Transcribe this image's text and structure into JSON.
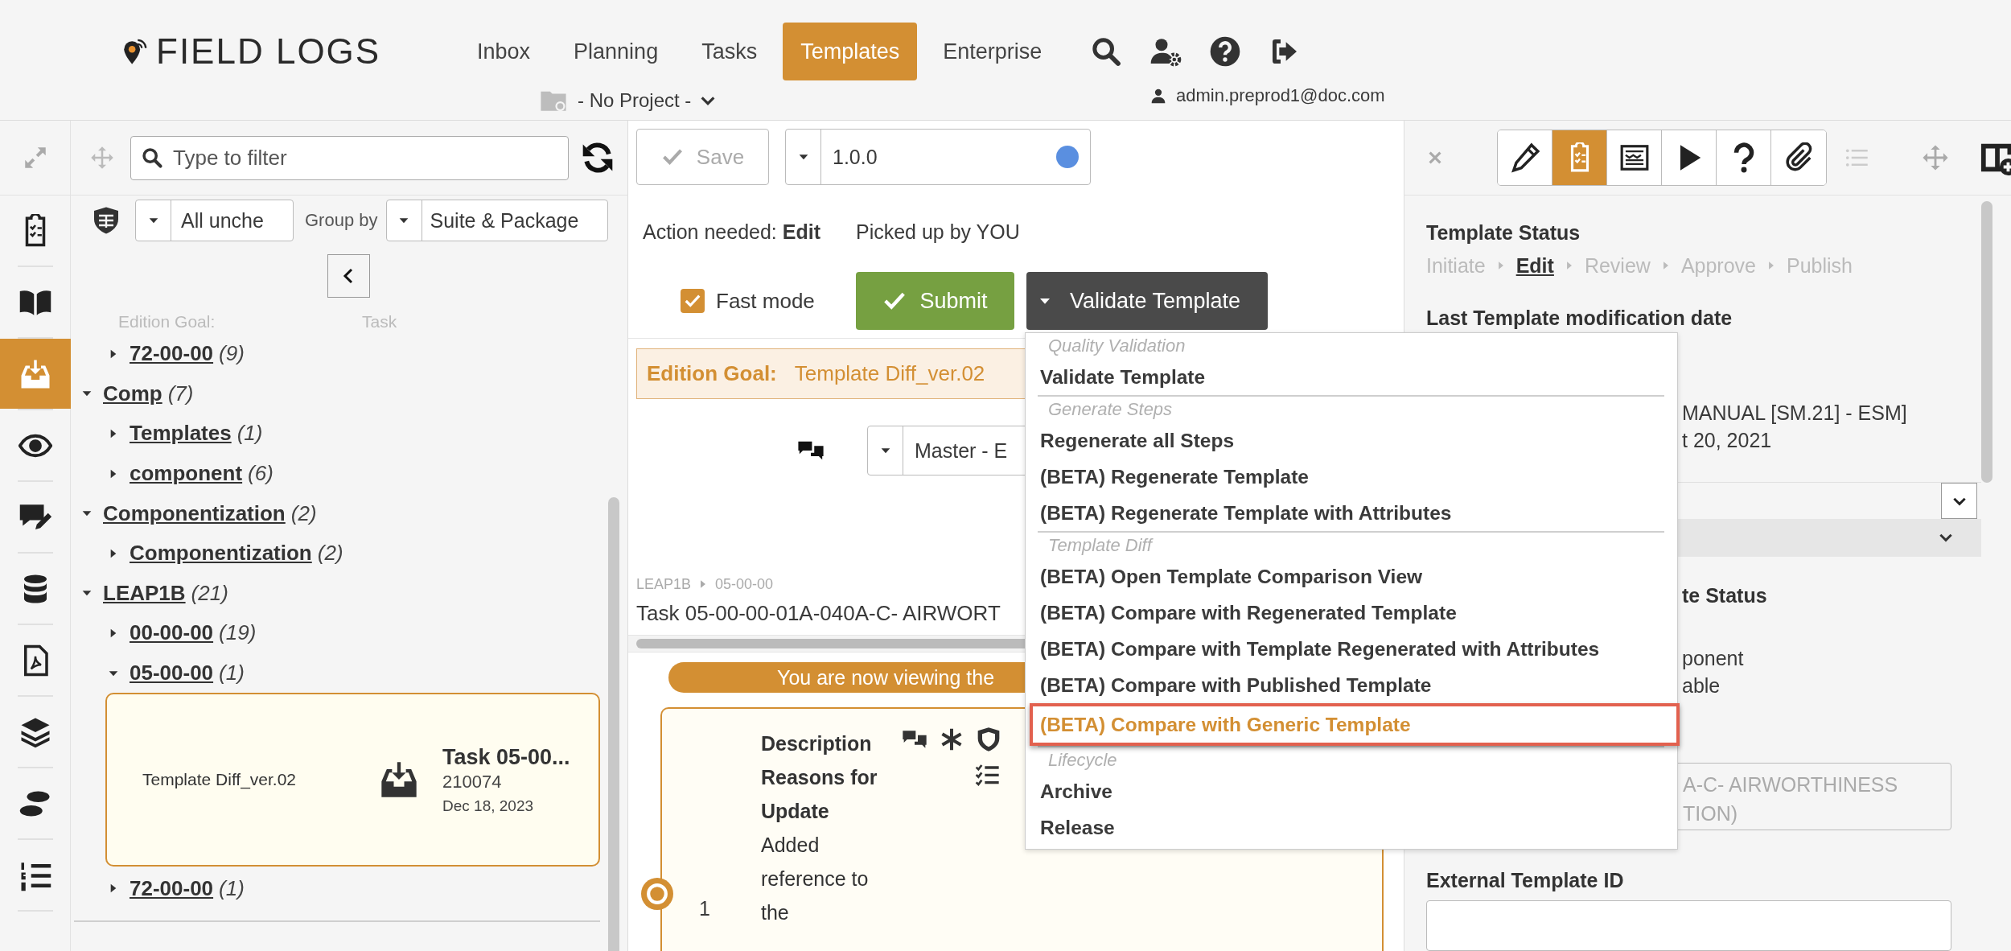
{
  "header": {
    "logo": "FIELD LOGS",
    "nav": [
      {
        "label": "Inbox",
        "selected": false
      },
      {
        "label": "Planning",
        "selected": false
      },
      {
        "label": "Tasks",
        "selected": false
      },
      {
        "label": "Templates",
        "selected": true
      },
      {
        "label": "Enterprise",
        "selected": false
      }
    ],
    "project": "- No Project -",
    "user": "admin.preprod1@doc.com"
  },
  "rail": {
    "items": [
      {
        "kind": "checklist",
        "selected": false
      },
      {
        "kind": "book",
        "selected": false
      },
      {
        "kind": "inbox",
        "selected": true
      },
      {
        "kind": "eye",
        "selected": false
      },
      {
        "kind": "comment-edit",
        "selected": false
      },
      {
        "kind": "database",
        "selected": false
      },
      {
        "kind": "pdf",
        "selected": false
      },
      {
        "kind": "layers",
        "selected": false
      },
      {
        "kind": "footsteps",
        "selected": false
      },
      {
        "kind": "numbered-list",
        "selected": false
      }
    ]
  },
  "left_panel": {
    "filter": {
      "placeholder": "Type to filter"
    },
    "status_filter": "All unche",
    "group_by": {
      "label": "Group by",
      "value": "Suite & Package"
    },
    "columns": [
      "Edition Goal:",
      "Task"
    ],
    "tree": [
      {
        "children": [
          {
            "label": "72-00-00",
            "count": "(9)",
            "expanded": false
          }
        ]
      },
      {
        "label": "Comp",
        "count": "(7)",
        "expanded": true,
        "children": [
          {
            "label": "Templates",
            "count": "(1)",
            "expanded": false
          },
          {
            "label": "component",
            "count": "(6)",
            "expanded": false
          }
        ]
      },
      {
        "label": "Componentization",
        "count": "(2)",
        "expanded": true,
        "children": [
          {
            "label": "Componentization",
            "count": "(2)",
            "expanded": false
          }
        ]
      },
      {
        "label": "LEAP1B",
        "count": "(21)",
        "expanded": true,
        "children": [
          {
            "label": "00-00-00",
            "count": "(19)",
            "expanded": false
          },
          {
            "label": "05-00-00",
            "count": "(1)",
            "expanded": true,
            "children": [
              {
                "kind": "card",
                "goal": "Template Diff_ver.02",
                "title": "Task 05-00...",
                "number": "210074",
                "date": "Dec 18, 2023",
                "selected": true
              }
            ]
          },
          {
            "label": "72-00-00",
            "count": "(1)",
            "expanded": false
          }
        ]
      }
    ]
  },
  "editor": {
    "save": {
      "label": "Save",
      "disabled": true
    },
    "version": "1.0.0",
    "action": {
      "label": "Action needed:",
      "value": "Edit"
    },
    "picked_up": "Picked up by YOU",
    "fast_mode": {
      "label": "Fast mode",
      "checked": true
    },
    "submit": "Submit",
    "validate": {
      "label": "Validate Template",
      "expanded": true
    },
    "edition_goal": {
      "label": "Edition Goal:",
      "value": "Template Diff_ver.02"
    },
    "language": "Master - E",
    "breadcrumb": [
      "LEAP1B",
      "05-00-00"
    ],
    "task_title": "Task 05-00-00-01A-040A-C- AIRWORT",
    "notice": "You are now viewing the",
    "step": {
      "number": "1",
      "heading": "Description Reasons for Update",
      "text": "Added reference to the"
    }
  },
  "validate_menu": {
    "sections": [
      {
        "title": "Quality Validation",
        "items": [
          {
            "label": "Validate Template",
            "selected": false
          }
        ]
      },
      {
        "title": "Generate Steps",
        "items": [
          {
            "label": "Regenerate all Steps",
            "selected": false
          },
          {
            "label": "(BETA) Regenerate Template",
            "selected": false
          },
          {
            "label": "(BETA) Regenerate Template with Attributes",
            "selected": false
          }
        ]
      },
      {
        "title": "Template Diff",
        "items": [
          {
            "label": "(BETA) Open Template Comparison View",
            "selected": false
          },
          {
            "label": "(BETA) Compare with Regenerated Template",
            "selected": false
          },
          {
            "label": "(BETA) Compare with Template Regenerated with Attributes",
            "selected": false
          },
          {
            "label": "(BETA) Compare with Published Template",
            "selected": false
          },
          {
            "label": "(BETA) Compare with Generic Template",
            "selected": true
          }
        ]
      },
      {
        "title": "Lifecycle",
        "items": [
          {
            "label": "Archive",
            "selected": false
          },
          {
            "label": "Release",
            "selected": false
          }
        ]
      }
    ]
  },
  "details": {
    "tools": [
      {
        "kind": "pencil",
        "selected": false
      },
      {
        "kind": "clipboard",
        "selected": true
      },
      {
        "kind": "form",
        "selected": false
      },
      {
        "kind": "play",
        "selected": false
      },
      {
        "kind": "question",
        "selected": false
      },
      {
        "kind": "paperclip",
        "selected": false
      }
    ],
    "status": {
      "title": "Template Status",
      "steps": [
        {
          "label": "Initiate",
          "selected": false
        },
        {
          "label": "Edit",
          "selected": true
        },
        {
          "label": "Review",
          "selected": false
        },
        {
          "label": "Approve",
          "selected": false
        },
        {
          "label": "Publish",
          "selected": false
        }
      ]
    },
    "modified_label": "Last Template modification date",
    "source_fragment": "MANUAL [SM.21] - ESM]",
    "date_fragment": "t 20, 2021",
    "status_heading_fragment": "te Status",
    "line_fragments": [
      "ponent",
      "able"
    ],
    "description_fragments": [
      "A-C- AIRWORTHINESS",
      "TION)"
    ],
    "external_id_label": "External Template ID"
  }
}
